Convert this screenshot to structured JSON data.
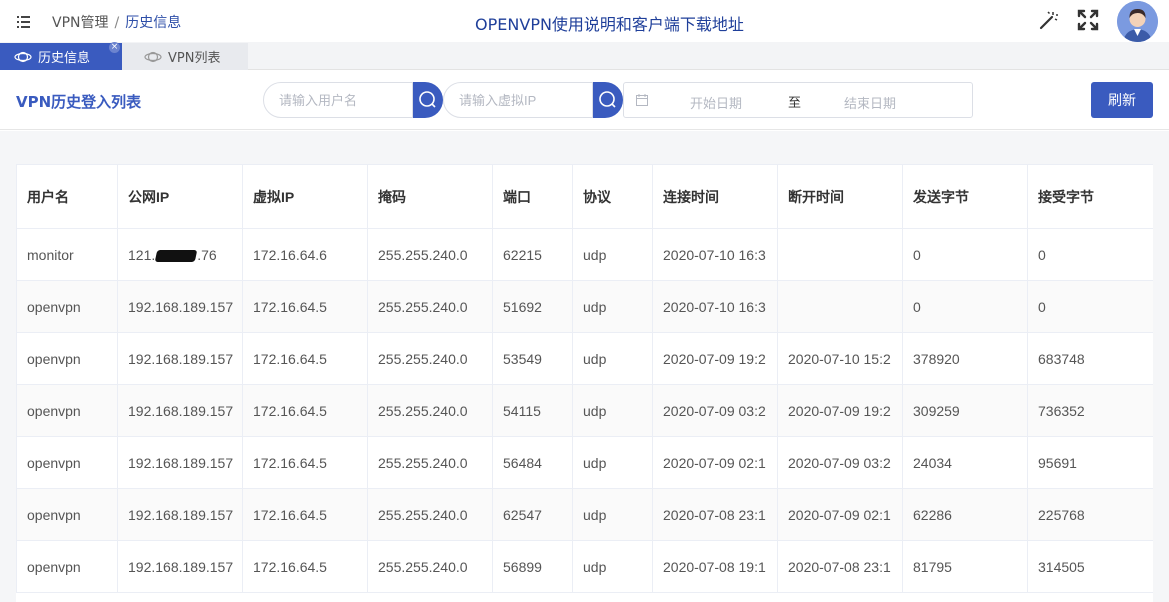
{
  "header": {
    "breadcrumb": [
      "VPN管理",
      "历史信息"
    ],
    "breadcrumb_sep": "/",
    "title": "OPENVPN使用说明和客户端下载地址"
  },
  "tabs": [
    {
      "label": "历史信息",
      "active": true,
      "icon": "tab-globe-icon"
    },
    {
      "label": "VPN列表",
      "active": false,
      "icon": "tab-globe-icon"
    }
  ],
  "toolbar": {
    "list_title": "VPN历史登入列表",
    "user_placeholder": "请输入用户名",
    "ip_placeholder": "请输入虚拟IP",
    "start_date_placeholder": "开始日期",
    "date_separator": "至",
    "end_date_placeholder": "结束日期",
    "refresh_label": "刷新"
  },
  "table": {
    "columns": [
      "用户名",
      "公网IP",
      "虚拟IP",
      "掩码",
      "端口",
      "协议",
      "连接时间",
      "断开时间",
      "发送字节",
      "接受字节"
    ],
    "rows": [
      {
        "user": "monitor",
        "public_ip_prefix": "121.",
        "public_ip_suffix": ".76",
        "public_ip_redacted": true,
        "virtual_ip": "172.16.64.6",
        "mask": "255.255.240.0",
        "port": "62215",
        "protocol": "udp",
        "connect_time": "2020-07-10 16:3",
        "disconnect_time": "",
        "sent": "0",
        "received": "0"
      },
      {
        "user": "openvpn",
        "public_ip": "192.168.189.157",
        "virtual_ip": "172.16.64.5",
        "mask": "255.255.240.0",
        "port": "51692",
        "protocol": "udp",
        "connect_time": "2020-07-10 16:3",
        "disconnect_time": "",
        "sent": "0",
        "received": "0"
      },
      {
        "user": "openvpn",
        "public_ip": "192.168.189.157",
        "virtual_ip": "172.16.64.5",
        "mask": "255.255.240.0",
        "port": "53549",
        "protocol": "udp",
        "connect_time": "2020-07-09 19:2",
        "disconnect_time": "2020-07-10 15:2",
        "sent": "378920",
        "received": "683748"
      },
      {
        "user": "openvpn",
        "public_ip": "192.168.189.157",
        "virtual_ip": "172.16.64.5",
        "mask": "255.255.240.0",
        "port": "54115",
        "protocol": "udp",
        "connect_time": "2020-07-09 03:2",
        "disconnect_time": "2020-07-09 19:2",
        "sent": "309259",
        "received": "736352"
      },
      {
        "user": "openvpn",
        "public_ip": "192.168.189.157",
        "virtual_ip": "172.16.64.5",
        "mask": "255.255.240.0",
        "port": "56484",
        "protocol": "udp",
        "connect_time": "2020-07-09 02:1",
        "disconnect_time": "2020-07-09 03:2",
        "sent": "24034",
        "received": "95691"
      },
      {
        "user": "openvpn",
        "public_ip": "192.168.189.157",
        "virtual_ip": "172.16.64.5",
        "mask": "255.255.240.0",
        "port": "62547",
        "protocol": "udp",
        "connect_time": "2020-07-08 23:1",
        "disconnect_time": "2020-07-09 02:1",
        "sent": "62286",
        "received": "225768"
      },
      {
        "user": "openvpn",
        "public_ip": "192.168.189.157",
        "virtual_ip": "172.16.64.5",
        "mask": "255.255.240.0",
        "port": "56899",
        "protocol": "udp",
        "connect_time": "2020-07-08 19:1",
        "disconnect_time": "2020-07-08 23:1",
        "sent": "81795",
        "received": "314505"
      }
    ]
  },
  "colors": {
    "accent": "#3a5bbf",
    "title_blue": "#1f3f9a"
  }
}
